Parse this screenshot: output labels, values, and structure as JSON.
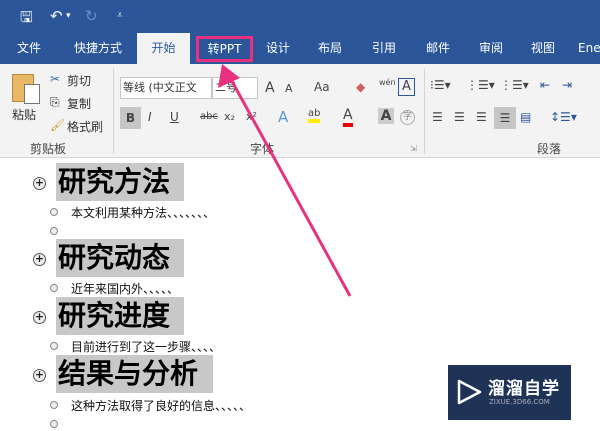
{
  "quick_access": {
    "save": "🖫",
    "undo": "↶",
    "undo_dropdown": "▾",
    "redo": "↻",
    "customize": "⩡"
  },
  "tabs": [
    "文件",
    "快捷方式",
    "开始",
    "转PPT",
    "设计",
    "布局",
    "引用",
    "邮件",
    "审阅",
    "视图",
    "Ene"
  ],
  "active_tab": "开始",
  "highlighted_tab": "转PPT",
  "ribbon": {
    "clipboard": {
      "paste": "粘贴",
      "cut": "剪切",
      "copy": "复制",
      "format_painter": "格式刷",
      "group": "剪贴板"
    },
    "font": {
      "font_name": "等线 (中文正文",
      "font_size": "二号",
      "grow": "A",
      "shrink": "A",
      "case": "Aa",
      "bold": "B",
      "italic": "I",
      "underline": "U",
      "strike": "abc",
      "sub": "x₂",
      "sup": "x²",
      "effects": "A",
      "highlight": "ab",
      "color": "A",
      "shade": "A",
      "enclose": "字",
      "phonetic": "wén",
      "border": "A",
      "group": "字体"
    },
    "paragraph": {
      "group": "段落"
    }
  },
  "document": {
    "items": [
      {
        "heading": "研究方法",
        "subs": [
          "本文利用某种方法、、、、、、、",
          ""
        ]
      },
      {
        "heading": "研究动态",
        "subs": [
          "近年来国内外、、、、、"
        ]
      },
      {
        "heading": "研究进度",
        "subs": [
          "目前进行到了这一步骤、、、、"
        ]
      },
      {
        "heading": "结果与分析",
        "subs": [
          "这种方法取得了良好的信息、、、、、",
          ""
        ]
      }
    ]
  },
  "watermark": {
    "name": "溜溜自学",
    "url": "ZIXUE.3D66.COM"
  },
  "colors": {
    "brand": "#2b579a",
    "annotation": "#e8317f"
  }
}
